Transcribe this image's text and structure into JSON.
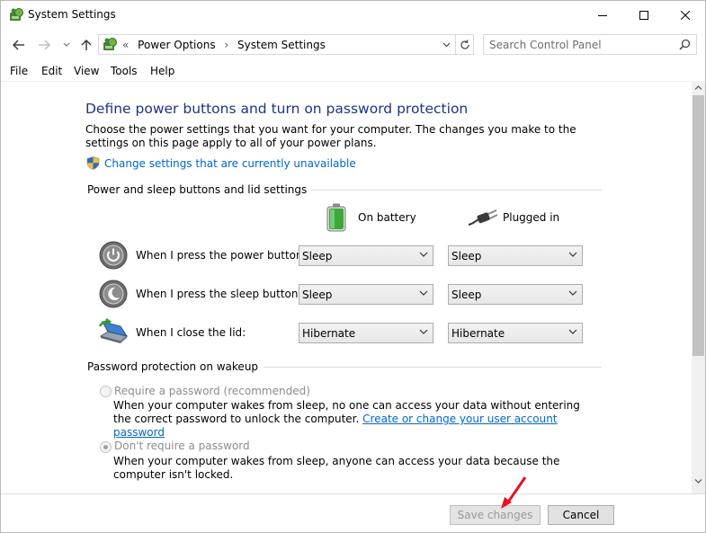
{
  "window": {
    "title": "System Settings"
  },
  "address": {
    "overflow": "«",
    "crumbs": [
      "Power Options",
      "System Settings"
    ],
    "separator": "›"
  },
  "search": {
    "placeholder": "Search Control Panel"
  },
  "menu": [
    "File",
    "Edit",
    "View",
    "Tools",
    "Help"
  ],
  "page": {
    "heading": "Define power buttons and turn on password protection",
    "description": "Choose the power settings that you want for your computer. The changes you make to the settings on this page apply to all of your power plans.",
    "change_link": "Change settings that are currently unavailable"
  },
  "buttons_section": {
    "title": "Power and sleep buttons and lid settings",
    "col_battery": "On battery",
    "col_plugged": "Plugged in",
    "rows": [
      {
        "label": "When I press the power button:",
        "battery": "Sleep",
        "plugged": "Sleep",
        "icon": "power-icon"
      },
      {
        "label": "When I press the sleep button:",
        "battery": "Sleep",
        "plugged": "Sleep",
        "icon": "sleep-icon"
      },
      {
        "label": "When I close the lid:",
        "battery": "Hibernate",
        "plugged": "Hibernate",
        "icon": "laptop-lid-icon"
      }
    ]
  },
  "password_section": {
    "title": "Password protection on wakeup",
    "require": {
      "label": "Require a password (recommended)",
      "desc": "When your computer wakes from sleep, no one can access your data without entering the correct password to unlock the computer.",
      "link": "Create or change your user account password",
      "selected": false
    },
    "dont_require": {
      "label": "Don't require a password",
      "desc": "When your computer wakes from sleep, anyone can access your data because the computer isn't locked.",
      "selected": true
    }
  },
  "footer": {
    "save": "Save changes",
    "cancel": "Cancel"
  },
  "colors": {
    "heading": "#1e3287",
    "link": "#0066cc",
    "annotation_arrow": "#e81123"
  }
}
